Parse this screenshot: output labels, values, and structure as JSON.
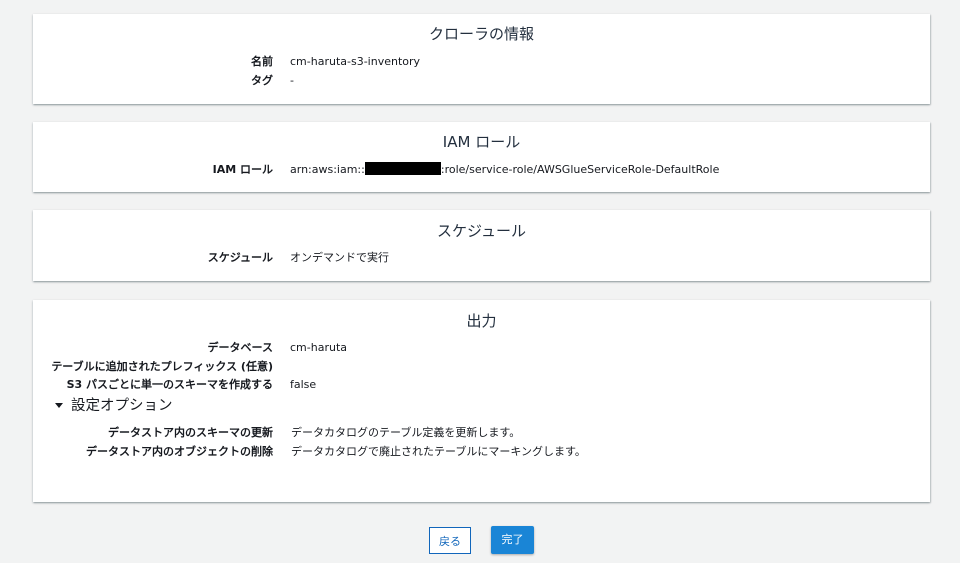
{
  "crawler_info": {
    "title": "クローラの情報",
    "rows": [
      {
        "label": "名前",
        "value": "cm-haruta-s3-inventory"
      },
      {
        "label": "タグ",
        "value": "-"
      }
    ]
  },
  "iam_role": {
    "title": "IAM ロール",
    "label": "IAM ロール",
    "value_prefix": "arn:aws:iam::",
    "value_suffix": ":role/service-role/AWSGlueServiceRole-DefaultRole"
  },
  "schedule": {
    "title": "スケジュール",
    "label": "スケジュール",
    "value": "オンデマンドで実行"
  },
  "output": {
    "title": "出力",
    "rows": [
      {
        "label": "データベース",
        "value": "cm-haruta"
      },
      {
        "label": "テーブルに追加されたプレフィックス (任意)",
        "value": ""
      },
      {
        "label": "S3 パスごとに単一のスキーマを作成する",
        "value": "false"
      }
    ],
    "options_toggle": "設定オプション",
    "option_rows": [
      {
        "label": "データストア内のスキーマの更新",
        "value": "データカタログのテーブル定義を更新します。"
      },
      {
        "label": "データストア内のオブジェクトの削除",
        "value": "データカタログで廃止されたテーブルにマーキングします。"
      }
    ]
  },
  "buttons": {
    "back": "戻る",
    "done": "完了"
  },
  "colors": {
    "primary": "#1a85d6",
    "link": "#1166bb",
    "background": "#f2f3f3"
  }
}
